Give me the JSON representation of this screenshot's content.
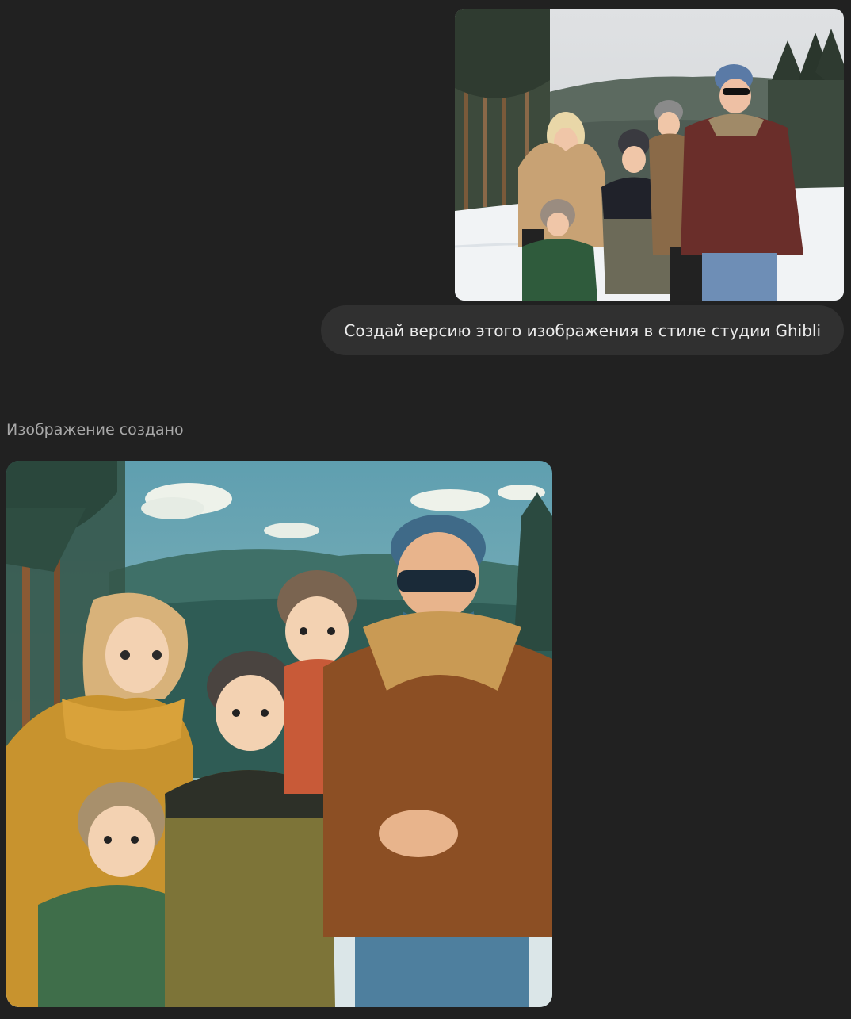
{
  "conversation": {
    "user_message": {
      "attachment": {
        "kind": "photo",
        "subject": "family-winter-photo"
      },
      "text": "Создай версию этого изображения в стиле студии Ghibli"
    },
    "assistant_message": {
      "status_text": "Изображение создано",
      "image": {
        "kind": "generated-image",
        "subject": "family-winter-ghibli-illustration"
      }
    }
  },
  "colors": {
    "background": "#212121",
    "user_bubble": "#303030",
    "text_primary": "#ececec",
    "text_secondary": "#a8a8a8"
  }
}
